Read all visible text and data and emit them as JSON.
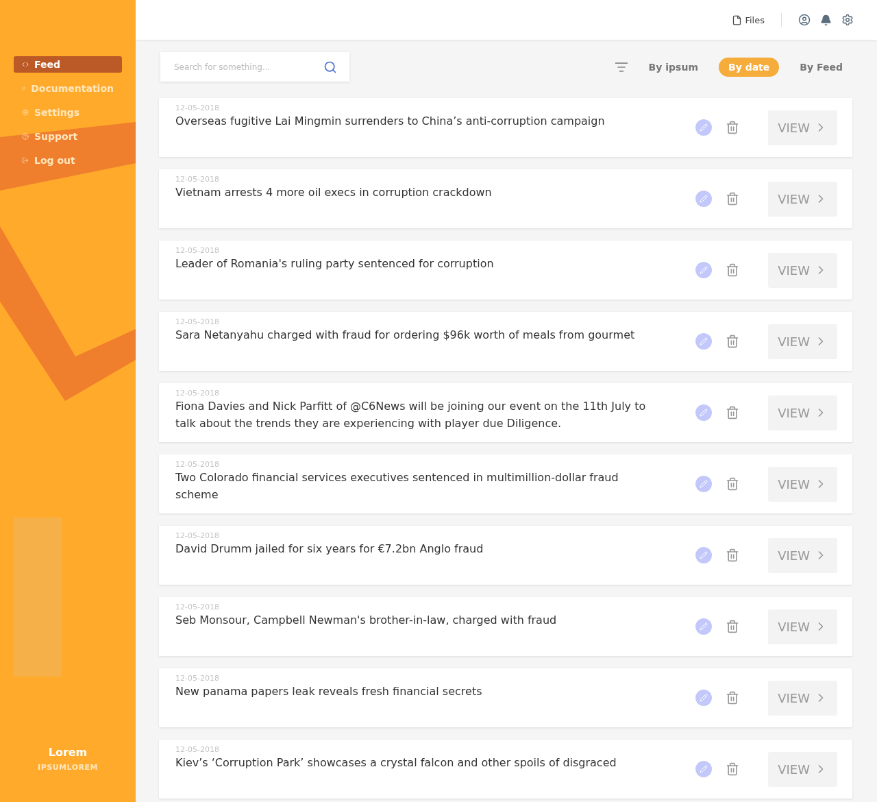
{
  "sidebar": {
    "items": [
      {
        "label": "Feed",
        "selected": true
      },
      {
        "label": "Documentation",
        "selected": false
      },
      {
        "label": "Settings",
        "selected": false
      },
      {
        "label": "Support",
        "selected": false
      },
      {
        "label": "Log out",
        "selected": false
      }
    ],
    "footer": {
      "title": "Lorem",
      "subtitle": "IPSUMLOREM"
    }
  },
  "header": {
    "files_label": "Files"
  },
  "search": {
    "placeholder": "Search for something..."
  },
  "sort_options": [
    {
      "label": "By ipsum",
      "selected": false
    },
    {
      "label": "By date",
      "selected": true
    },
    {
      "label": "By Feed",
      "selected": false
    }
  ],
  "feed": [
    {
      "date": "12-05-2018",
      "title": "Overseas fugitive Lai Mingmin surrenders to China’s anti-corruption campaign",
      "action": "VIEW"
    },
    {
      "date": "12-05-2018",
      "title": "Vietnam arrests 4 more oil execs in corruption crackdown",
      "action": "VIEW"
    },
    {
      "date": "12-05-2018",
      "title": "Leader of Romania's ruling party sentenced for corruption",
      "action": "VIEW"
    },
    {
      "date": "12-05-2018",
      "title": "Sara Netanyahu charged with fraud for ordering $96k worth of meals from gourmet",
      "action": "VIEW"
    },
    {
      "date": "12-05-2018",
      "title": "Fiona Davies and Nick Parfitt of @C6News will be joining our event on the 11th July to talk about the trends they are experiencing with player due Diligence.",
      "action": "VIEW"
    },
    {
      "date": "12-05-2018",
      "title": "Two Colorado financial services executives sentenced in multimillion-dollar fraud scheme",
      "action": "VIEW"
    },
    {
      "date": "12-05-2018",
      "title": "David Drumm jailed for six years for €7.2bn Anglo fraud",
      "action": "VIEW"
    },
    {
      "date": "12-05-2018",
      "title": "Seb Monsour, Campbell Newman's brother-in-law, charged with fraud",
      "action": "VIEW"
    },
    {
      "date": "12-05-2018",
      "title": "New panama papers leak reveals fresh financial secrets",
      "action": "VIEW"
    },
    {
      "date": "12-05-2018",
      "title": "Kiev’s ‘Corruption Park’ showcases a crystal falcon and other spoils of disgraced",
      "action": "VIEW"
    }
  ]
}
